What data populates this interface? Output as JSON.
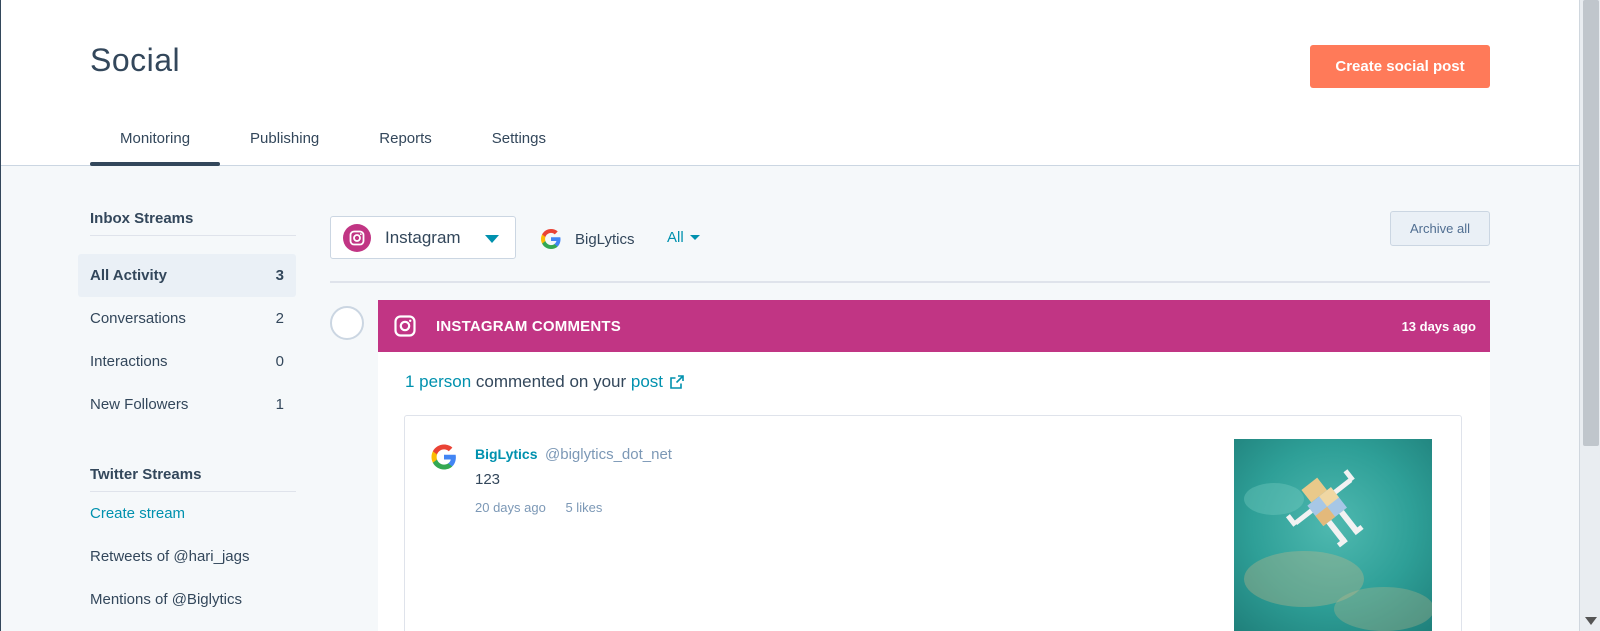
{
  "header": {
    "title": "Social",
    "create_button": "Create social post",
    "tabs": [
      {
        "label": "Monitoring",
        "active": true
      },
      {
        "label": "Publishing",
        "active": false
      },
      {
        "label": "Reports",
        "active": false
      },
      {
        "label": "Settings",
        "active": false
      }
    ]
  },
  "sidebar": {
    "inbox_heading": "Inbox Streams",
    "inbox_items": [
      {
        "label": "All Activity",
        "count": "3"
      },
      {
        "label": "Conversations",
        "count": "2"
      },
      {
        "label": "Interactions",
        "count": "0"
      },
      {
        "label": "New Followers",
        "count": "1"
      }
    ],
    "twitter_heading": "Twitter Streams",
    "create_stream": "Create stream",
    "twitter_items": [
      "Retweets of @hari_jags",
      "Mentions of @Biglytics"
    ]
  },
  "filters": {
    "network": "Instagram",
    "brand": "BigLytics",
    "scope": "All",
    "archive_button": "Archive all"
  },
  "card": {
    "title": "INSTAGRAM COMMENTS",
    "time": "13 days ago",
    "summary_count": "1 person",
    "summary_text": "commented on your",
    "summary_link": "post",
    "comment": {
      "author": "BigLytics",
      "handle": "@biglytics_dot_net",
      "text": "123",
      "time": "20 days ago",
      "likes": "5 likes"
    }
  },
  "colors": {
    "accent_orange": "#ff7a59",
    "instagram": "#c13584",
    "link": "#0091ae",
    "text": "#33475b"
  },
  "icons": {
    "network_icon": "instagram-icon",
    "brand_icon": "google-logo-icon",
    "external_link": "external-link-icon"
  }
}
